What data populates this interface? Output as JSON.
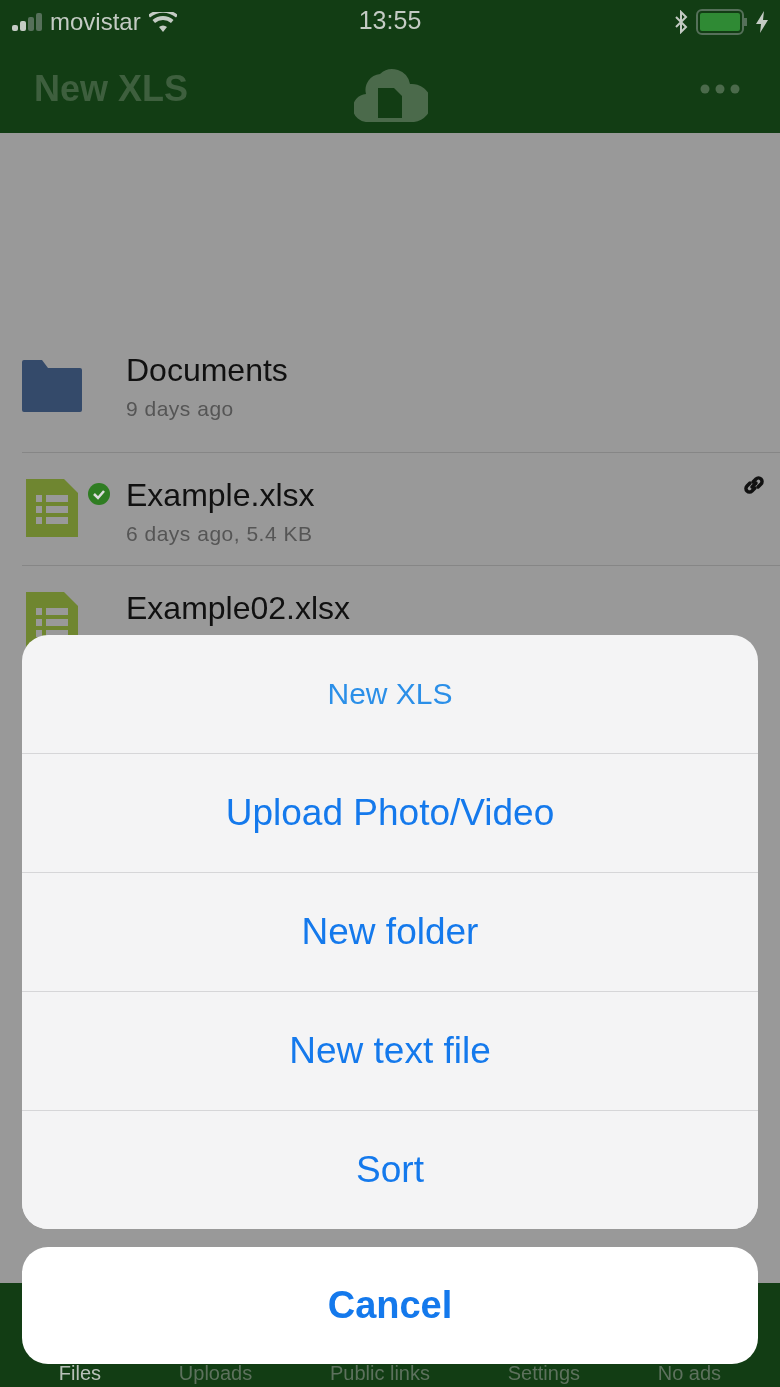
{
  "status_bar": {
    "carrier": "movistar",
    "time": "13:55",
    "charging": true
  },
  "nav_bar": {
    "title": "New XLS"
  },
  "files": [
    {
      "kind": "folder",
      "name": "Documents",
      "details": "9 days ago",
      "synced": false,
      "shared": false
    },
    {
      "kind": "spreadsheet",
      "name": "Example.xlsx",
      "details": "6 days ago, 5.4 KB",
      "synced": true,
      "shared": true
    },
    {
      "kind": "spreadsheet",
      "name": "Example02.xlsx",
      "synced": false,
      "shared": false
    }
  ],
  "action_sheet": {
    "title": "New XLS",
    "actions": [
      "Upload Photo/Video",
      "New folder",
      "New text file",
      "Sort"
    ],
    "cancel": "Cancel"
  },
  "tab_bar": [
    {
      "label": "Files",
      "selected": true
    },
    {
      "label": "Uploads",
      "selected": false
    },
    {
      "label": "Public links",
      "selected": false
    },
    {
      "label": "Settings",
      "selected": false
    },
    {
      "label": "No ads",
      "selected": false
    }
  ]
}
